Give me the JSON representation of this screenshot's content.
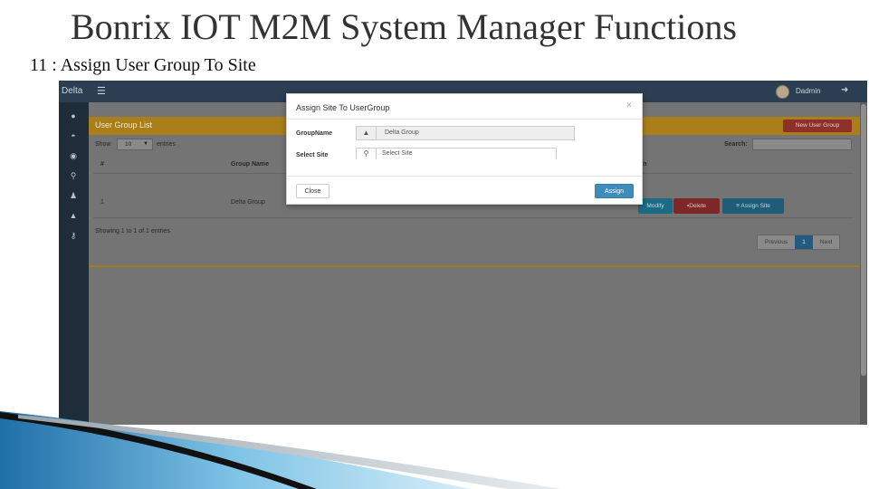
{
  "slide": {
    "title": "Bonrix IOT M2M System Manager Functions",
    "subtitle": "11 : Assign User Group To Site"
  },
  "app": {
    "brand": "Delta",
    "user": "Dadmin"
  },
  "panel": {
    "title": "User Group List",
    "new_button": "New User Group",
    "show_label": "Show",
    "show_value": "10",
    "entries_label": "entries",
    "search_label": "Search:",
    "columns": [
      "#",
      "Group Name",
      "on"
    ],
    "rows": [
      {
        "id": "1",
        "group_name": "Delta Group"
      }
    ],
    "actions": {
      "modify": "Modify",
      "delete": "Delete",
      "assign": "Assign Site"
    },
    "showing": "Showing 1 to 1 of 1 entries",
    "pager": {
      "previous": "Previous",
      "page": "1",
      "next": "Next"
    }
  },
  "modal": {
    "title": "Assign Site To UserGroup",
    "close_x": "×",
    "group_label": "GroupName",
    "group_value": "Delta Group",
    "site_label": "Select Site",
    "site_placeholder": "Select Site",
    "close_button": "Close",
    "assign_button": "Assign"
  },
  "colors": {
    "accent": "#aa7f1a",
    "primary": "#3c8dbc",
    "danger": "#8e2f2a",
    "sidebar": "#1f2d3a"
  }
}
